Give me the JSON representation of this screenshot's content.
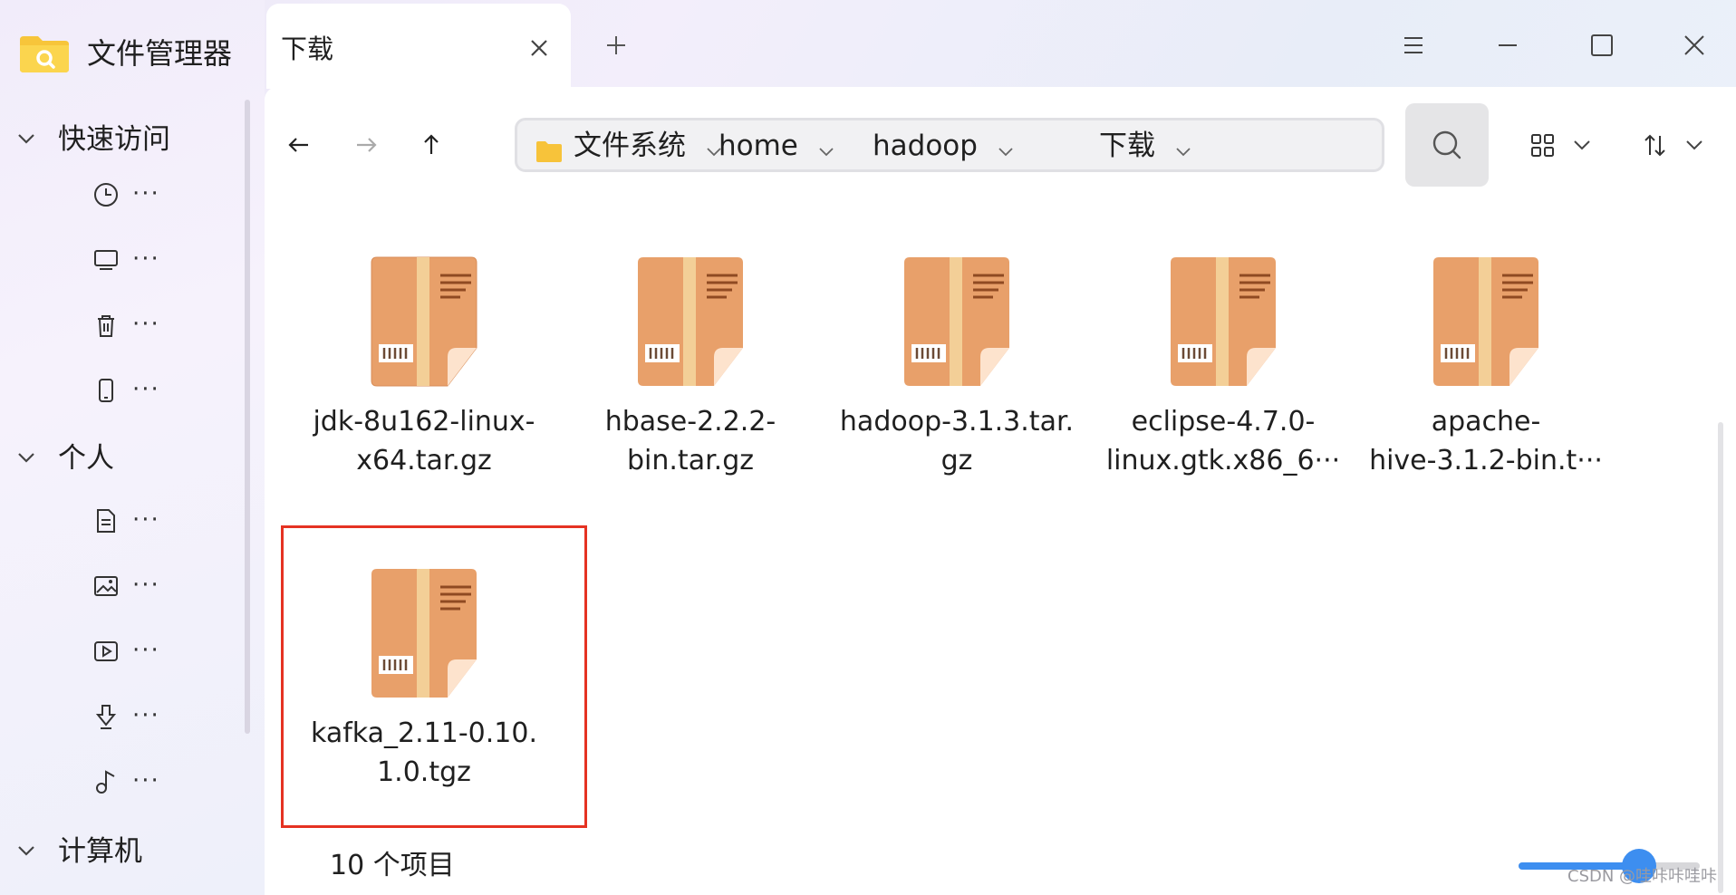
{
  "app": {
    "title": "文件管理器",
    "icon": "folder-search-icon"
  },
  "sidebar": {
    "sections": [
      {
        "label": "快速访问",
        "items": [
          {
            "icon": "clock-icon",
            "label": "···"
          },
          {
            "icon": "desktop-icon",
            "label": "···"
          },
          {
            "icon": "trash-icon",
            "label": "···"
          },
          {
            "icon": "phone-icon",
            "label": "···"
          }
        ]
      },
      {
        "label": "个人",
        "items": [
          {
            "icon": "document-icon",
            "label": "···"
          },
          {
            "icon": "picture-icon",
            "label": "···"
          },
          {
            "icon": "video-icon",
            "label": "···"
          },
          {
            "icon": "download-icon",
            "label": "···"
          },
          {
            "icon": "music-icon",
            "label": "···"
          }
        ]
      },
      {
        "label": "计算机"
      }
    ]
  },
  "tab": {
    "label": "下载"
  },
  "breadcrumb": [
    "文件系统",
    "home",
    "hadoop",
    "下载"
  ],
  "files": [
    {
      "line1": "jdk-8u162-linux-",
      "line2": "x64.tar.gz"
    },
    {
      "line1": "hbase-2.2.2-",
      "line2": "bin.tar.gz"
    },
    {
      "line1": "hadoop-3.1.3.tar.",
      "line2": "gz"
    },
    {
      "line1": "eclipse-4.7.0-",
      "line2": "linux.gtk.x86_6···"
    },
    {
      "line1": "apache-",
      "line2": "hive-3.1.2-bin.t···"
    },
    {
      "line1": "kafka_2.11-0.10.",
      "line2": "1.0.tgz",
      "selected": true
    }
  ],
  "status": {
    "item_count": "10 个项目"
  },
  "zoom": {
    "level": 0.67
  },
  "watermark": "CSDN @哇咔咔哇咔",
  "colors": {
    "accent": "#3d8ef0",
    "selection_border": "#e53222",
    "package": "#e9a470"
  }
}
